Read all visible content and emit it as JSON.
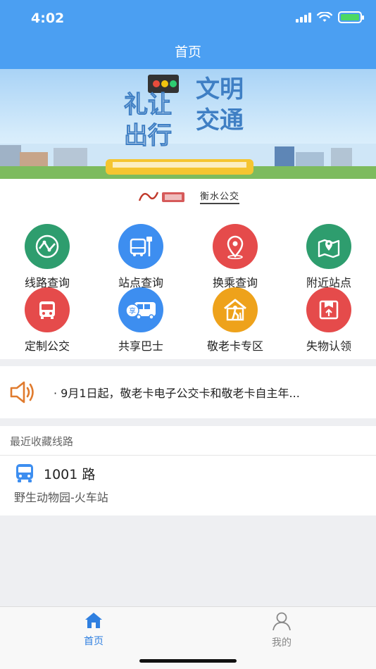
{
  "status_bar": {
    "time": "4:02"
  },
  "nav": {
    "title": "首页"
  },
  "banner": {
    "alt_text": "文明交通 礼让出行"
  },
  "logo_strip": {
    "brand_text": "衡水公交"
  },
  "grid": {
    "items": [
      {
        "label": "线路查询",
        "icon": "route-icon",
        "color": "#2e9d6e"
      },
      {
        "label": "站点查询",
        "icon": "bus-stop-icon",
        "color": "#3d8ef0"
      },
      {
        "label": "换乘查询",
        "icon": "location-pin-icon",
        "color": "#e54b4b"
      },
      {
        "label": "附近站点",
        "icon": "map-pin-icon",
        "color": "#2e9d6e"
      },
      {
        "label": "定制公交",
        "icon": "bus-front-icon",
        "color": "#e54b4b"
      },
      {
        "label": "共享巴士",
        "icon": "shared-bus-icon",
        "color": "#3d8ef0"
      },
      {
        "label": "敬老卡专区",
        "icon": "elderly-icon",
        "color": "#eea21b"
      },
      {
        "label": "失物认领",
        "icon": "lost-found-icon",
        "color": "#e54b4b"
      }
    ]
  },
  "notice": {
    "text": "· 9月1日起，敬老卡电子公交卡和敬老卡自主年..."
  },
  "favorites": {
    "header": "最近收藏线路",
    "route_name": "1001 路",
    "route_stops": "野生动物园-火车站"
  },
  "tabbar": {
    "home_label": "首页",
    "mine_label": "我的",
    "active_color": "#2f7fe0",
    "inactive_color": "#888888"
  }
}
